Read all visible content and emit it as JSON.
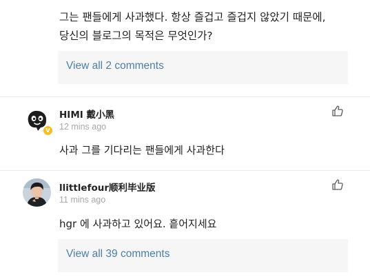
{
  "previous_comment": {
    "text": "그는 팬들에게 사과했다. 항상 즐겁고 즐겁지 않았기 때문에,\n당신의 블로그의 목적은 무엇인가?"
  },
  "view_all_1": {
    "label": "View all 2 comments"
  },
  "comments": [
    {
      "username": "HIMI 戴小黑",
      "time": "12 mins ago",
      "text": "사과 그를 기다리는 팬들에게 사과한다",
      "badge": "V",
      "avatar_icon": "black-blob-character-avatar"
    },
    {
      "username": "llittlefour顺利毕业版",
      "time": "11 mins ago",
      "text": "hgr 에 사과하고 있어요. 흩어지세요",
      "avatar_icon": "person-photo-avatar"
    }
  ],
  "view_all_2": {
    "label": "View all 39 comments"
  },
  "colors": {
    "link": "#4d7ea8",
    "timestamp": "#a8a8a8",
    "panel": "#f6f6f6",
    "badge": "#f4bf26"
  }
}
